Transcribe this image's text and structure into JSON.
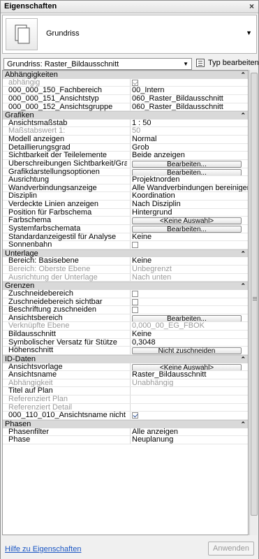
{
  "window": {
    "title": "Eigenschaften",
    "close_icon": "×"
  },
  "type_selector": {
    "type_name": "Grundriss"
  },
  "instance_selector": {
    "value": "Grundriss: Raster_Bildausschnitt",
    "edit_type_label": "Typ bearbeiten"
  },
  "sections": [
    {
      "label": "Abhängigkeiten",
      "rows": [
        {
          "name": "abhängig",
          "type": "checkbox",
          "checked": true,
          "disabled": true
        },
        {
          "name": "000_000_150_Fachbereich",
          "type": "text",
          "value": "00_Intern"
        },
        {
          "name": "000_000_151_Ansichtstyp",
          "type": "text",
          "value": "060_Raster_Bildausschnitt"
        },
        {
          "name": "000_000_152_Ansichtsgruppe",
          "type": "text",
          "value": "060_Raster_Bildausschnitt"
        }
      ]
    },
    {
      "label": "Grafiken",
      "rows": [
        {
          "name": "Ansichtsmaßstab",
          "type": "text",
          "value": "1 : 50"
        },
        {
          "name": "Maßstabswert 1:",
          "type": "text",
          "value": "50",
          "disabled": true
        },
        {
          "name": "Modell anzeigen",
          "type": "text",
          "value": "Normal"
        },
        {
          "name": "Detaillierungsgrad",
          "type": "text",
          "value": "Grob"
        },
        {
          "name": "Sichtbarkeit der Teilelemente",
          "type": "text",
          "value": "Beide anzeigen"
        },
        {
          "name": "Überschreibungen Sichtbarkeit/Grafiken",
          "type": "button",
          "value": "Bearbeiten..."
        },
        {
          "name": "Grafikdarstellungsoptionen",
          "type": "button",
          "value": "Bearbeiten..."
        },
        {
          "name": "Ausrichtung",
          "type": "text",
          "value": "Projektnorden"
        },
        {
          "name": "Wandverbindungsanzeige",
          "type": "text",
          "value": "Alle Wandverbindungen bereinigen"
        },
        {
          "name": "Disziplin",
          "type": "text",
          "value": "Koordination"
        },
        {
          "name": "Verdeckte Linien anzeigen",
          "type": "text",
          "value": "Nach Disziplin"
        },
        {
          "name": "Position für Farbschema",
          "type": "text",
          "value": "Hintergrund"
        },
        {
          "name": "Farbschema",
          "type": "button",
          "value": "<Keine Auswahl>"
        },
        {
          "name": "Systemfarbschemata",
          "type": "button",
          "value": "Bearbeiten..."
        },
        {
          "name": "Standardanzeigestil für Analyse",
          "type": "text",
          "value": "Keine"
        },
        {
          "name": "Sonnenbahn",
          "type": "checkbox",
          "checked": false
        }
      ]
    },
    {
      "label": "Unterlage",
      "rows": [
        {
          "name": "Bereich: Basisebene",
          "type": "text",
          "value": "Keine"
        },
        {
          "name": "Bereich: Oberste Ebene",
          "type": "text",
          "value": "Unbegrenzt",
          "disabled": true
        },
        {
          "name": "Ausrichtung der Unterlage",
          "type": "text",
          "value": "Nach unten",
          "disabled": true
        }
      ]
    },
    {
      "label": "Grenzen",
      "rows": [
        {
          "name": "Zuschneidebereich",
          "type": "checkbox",
          "checked": false
        },
        {
          "name": "Zuschneidebereich sichtbar",
          "type": "checkbox",
          "checked": false
        },
        {
          "name": "Beschriftung zuschneiden",
          "type": "checkbox",
          "checked": false
        },
        {
          "name": "Ansichtsbereich",
          "type": "button",
          "value": "Bearbeiten..."
        },
        {
          "name": "Verknüpfte Ebene",
          "type": "text",
          "value": "0,000_00_EG_FBOK",
          "disabled": true
        },
        {
          "name": "Bildausschnitt",
          "type": "text",
          "value": "Keine"
        },
        {
          "name": "Symbolischer Versatz für Stütze",
          "type": "text",
          "value": "0,3048"
        },
        {
          "name": "Höhenschnitt",
          "type": "button",
          "value": "Nicht zuschneiden"
        }
      ]
    },
    {
      "label": "ID-Daten",
      "rows": [
        {
          "name": "Ansichtsvorlage",
          "type": "button",
          "value": "<Keine Auswahl>"
        },
        {
          "name": "Ansichtsname",
          "type": "text",
          "value": "Raster_Bildausschnitt"
        },
        {
          "name": "Abhängigkeit",
          "type": "text",
          "value": "Unabhängig",
          "disabled": true
        },
        {
          "name": "Titel auf Plan",
          "type": "text",
          "value": ""
        },
        {
          "name": "Referenziert Plan",
          "type": "text",
          "value": "",
          "disabled": true
        },
        {
          "name": "Referenziert Detail",
          "type": "text",
          "value": "",
          "disabled": true
        },
        {
          "name": "000_110_010_Ansichtsname nicht auto...",
          "type": "checkbox",
          "checked": true
        }
      ]
    },
    {
      "label": "Phasen",
      "rows": [
        {
          "name": "Phasenfilter",
          "type": "text",
          "value": "Alle anzeigen"
        },
        {
          "name": "Phase",
          "type": "text",
          "value": "Neuplanung"
        }
      ]
    }
  ],
  "footer": {
    "help_link": "Hilfe zu Eigenschaften",
    "apply_label": "Anwenden"
  }
}
